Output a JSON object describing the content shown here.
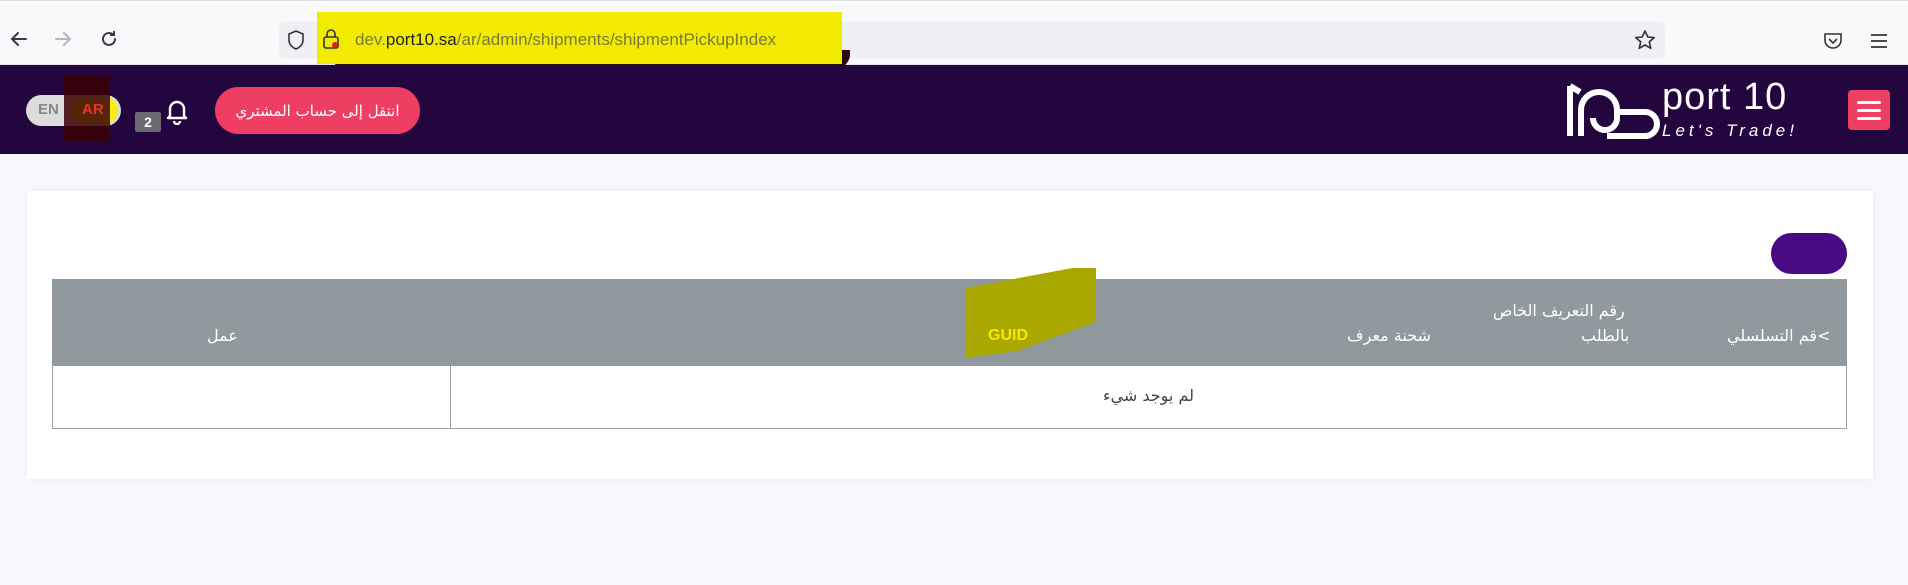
{
  "browser": {
    "url_host_prefix": "dev.",
    "url_host": "port10.sa",
    "url_path": "/ar/admin/shipments/shipmentPickupIndex"
  },
  "header": {
    "lang_en": "EN",
    "lang_ar": "AR",
    "notification_count": "2",
    "customer_button": "انتقل إلى حساب المشتري",
    "logo_name": "port 10",
    "logo_tagline": "Let's Trade!",
    "colors": {
      "background": "#24063e",
      "accent": "#ee3e62"
    }
  },
  "table": {
    "columns": {
      "serial": "قم التسلسلي<",
      "request_id_line1": "رقم التعريف الخاص",
      "request_id_line2": "بالطلب",
      "shipment_id": "شحنة معرف",
      "guid": "GUID",
      "action": "عمل"
    },
    "empty_message": "لم يوجد شيء"
  }
}
